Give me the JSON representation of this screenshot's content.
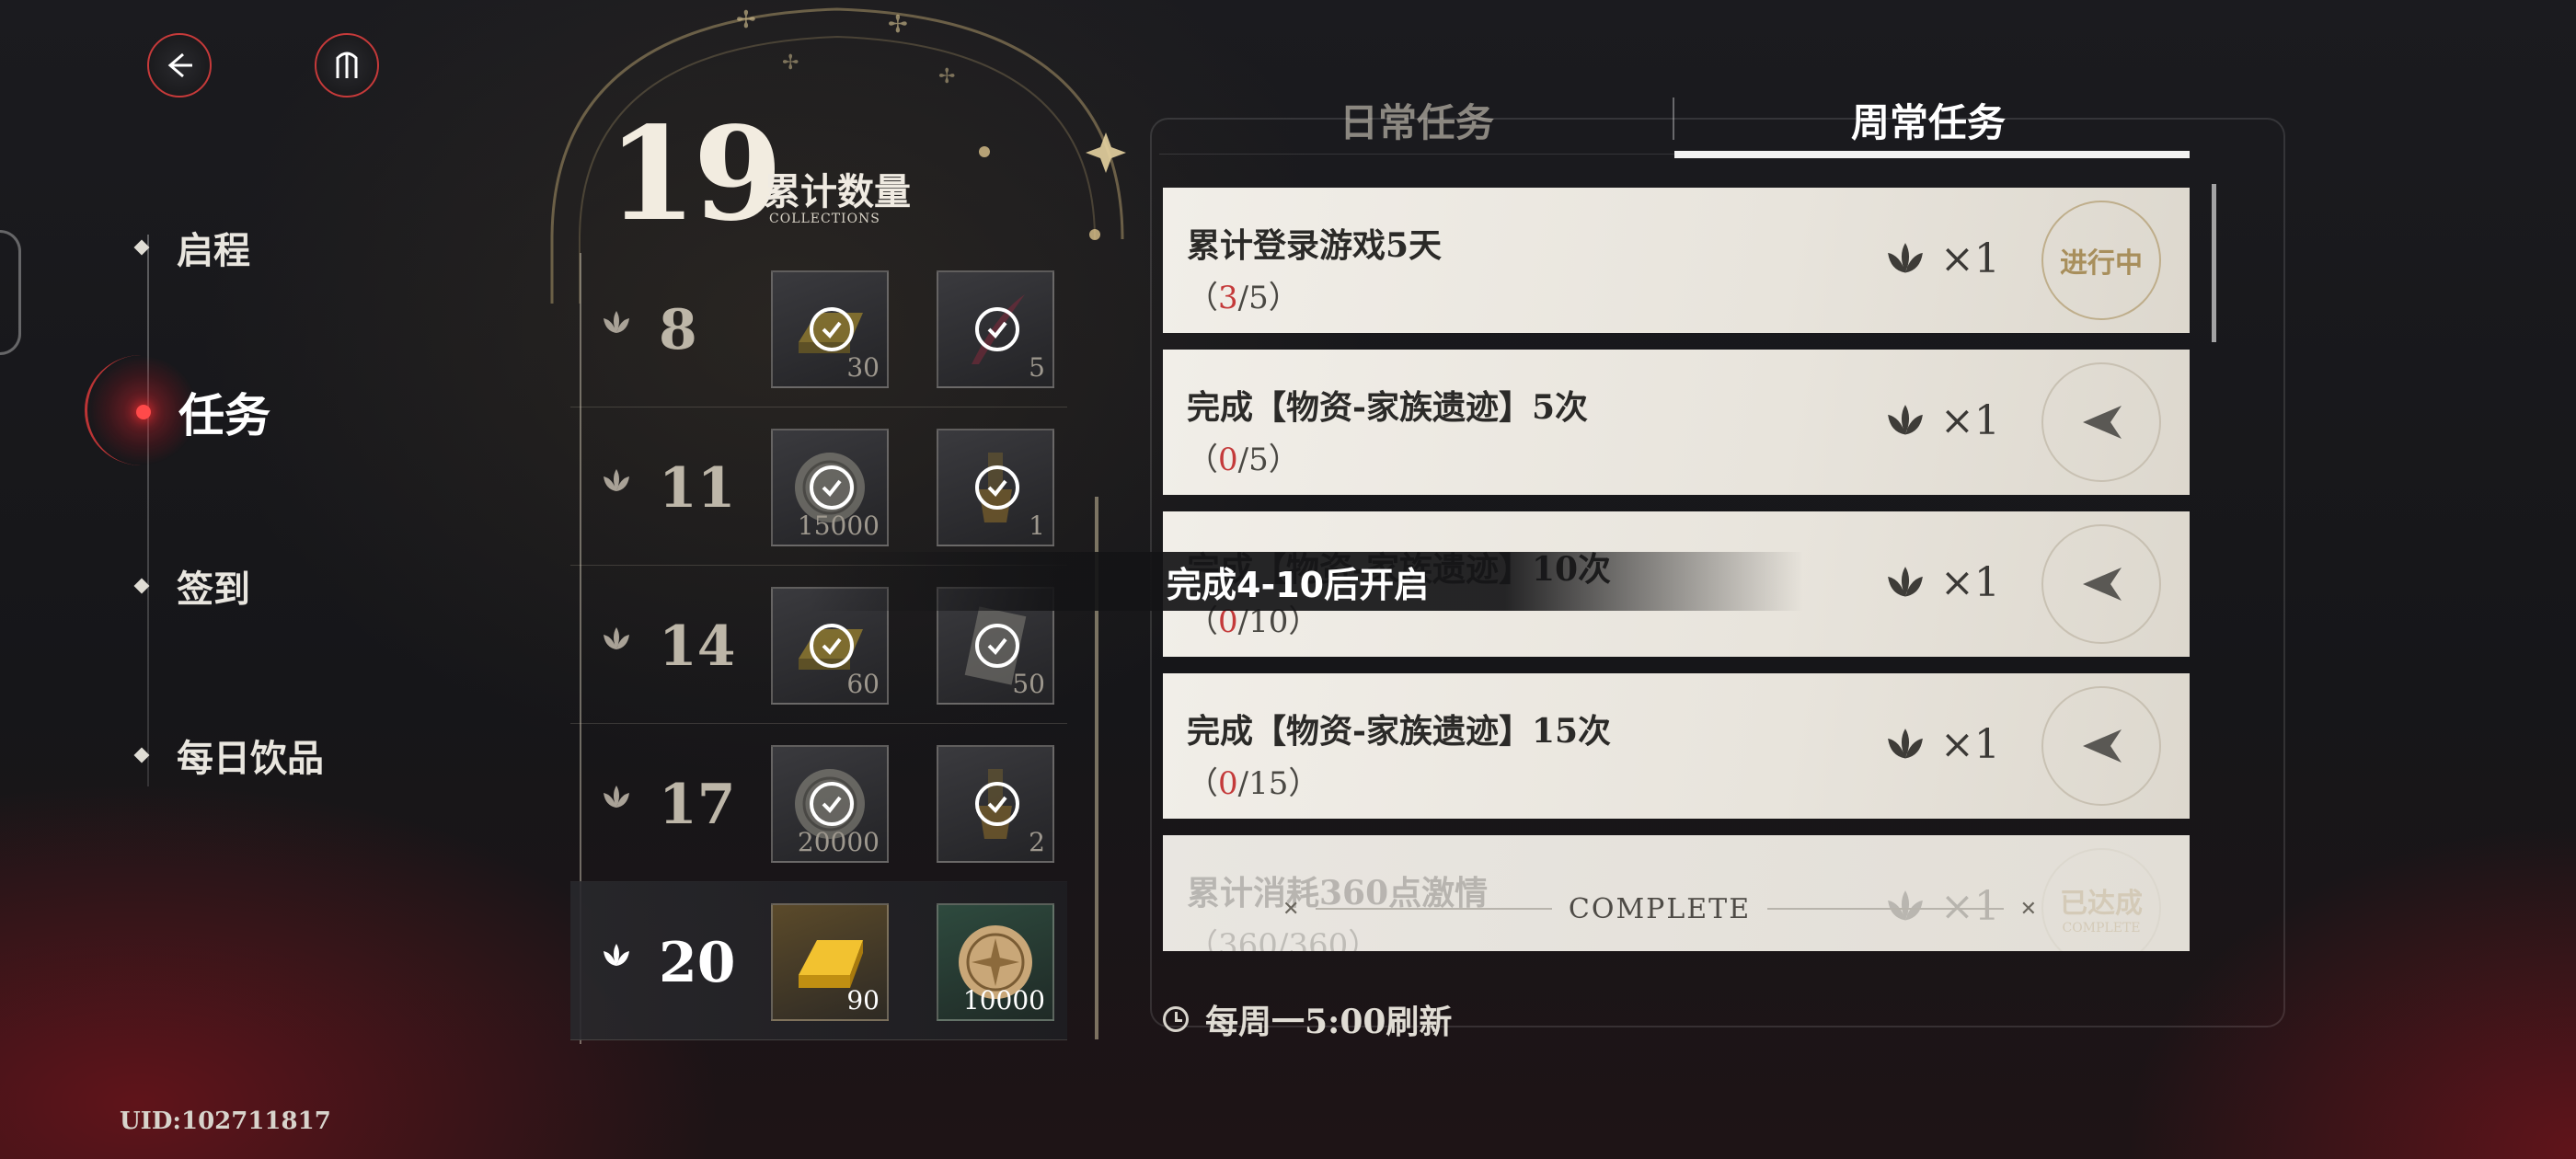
{
  "header": {
    "back_icon": "back-arrow-icon",
    "emblem_icon": "emblem-icon"
  },
  "nav": {
    "items": [
      {
        "label": "启程"
      },
      {
        "label": "任务"
      },
      {
        "label": "签到"
      },
      {
        "label": "每日饮品"
      }
    ],
    "active_index": 1,
    "uid": "UID:102711817"
  },
  "collection": {
    "total": "19",
    "label": "累计数量",
    "sub_label": "COLLECTIONS"
  },
  "milestones": [
    {
      "threshold": "8",
      "rewards": [
        {
          "icon": "gold-bar-icon",
          "qty": "30",
          "claimed": true
        },
        {
          "icon": "quill-icon",
          "qty": "5",
          "claimed": true
        }
      ]
    },
    {
      "threshold": "11",
      "rewards": [
        {
          "icon": "coin-icon",
          "qty": "15000",
          "claimed": true
        },
        {
          "icon": "tassel-icon",
          "qty": "1",
          "claimed": true
        }
      ]
    },
    {
      "threshold": "14",
      "rewards": [
        {
          "icon": "gold-bar-icon",
          "qty": "60",
          "claimed": true
        },
        {
          "icon": "ticket-icon",
          "qty": "50",
          "claimed": true
        }
      ]
    },
    {
      "threshold": "17",
      "rewards": [
        {
          "icon": "coin-icon",
          "qty": "20000",
          "claimed": true
        },
        {
          "icon": "tassel-icon",
          "qty": "2",
          "claimed": true
        }
      ]
    },
    {
      "threshold": "20",
      "rewards": [
        {
          "icon": "gold-bar-icon",
          "qty": "90",
          "claimed": false
        },
        {
          "icon": "coin-icon",
          "qty": "10000",
          "claimed": false
        }
      ]
    }
  ],
  "tabs": {
    "daily": "日常任务",
    "weekly": "周常任务",
    "active": "weekly"
  },
  "tasks": [
    {
      "title": "累计登录游戏5天",
      "current": "3",
      "total": "5",
      "reward_count": "×1",
      "status": "进行中",
      "state": "in-progress"
    },
    {
      "title": "完成【物资-家族遗迹】5次",
      "current": "0",
      "total": "5",
      "reward_count": "×1",
      "state": "go"
    },
    {
      "title": "完成【物资-家族遗迹】10次",
      "current": "0",
      "total": "10",
      "reward_count": "×1",
      "state": "go"
    },
    {
      "title": "完成【物资-家族遗迹】15次",
      "current": "0",
      "total": "15",
      "reward_count": "×1",
      "state": "go"
    },
    {
      "title": "累计消耗360点激情",
      "current": "360",
      "total": "360",
      "reward_count": "×1",
      "status": "已达成",
      "status_sub": "COMPLETE",
      "state": "complete",
      "complete_label": "COMPLETE"
    }
  ],
  "lock_banner": "完成4-10后开启",
  "refresh": "每周一5:00刷新",
  "colors": {
    "accent_red": "#c43a3a",
    "card_bg": "#f1eee8",
    "gold": "#a88f5c"
  }
}
